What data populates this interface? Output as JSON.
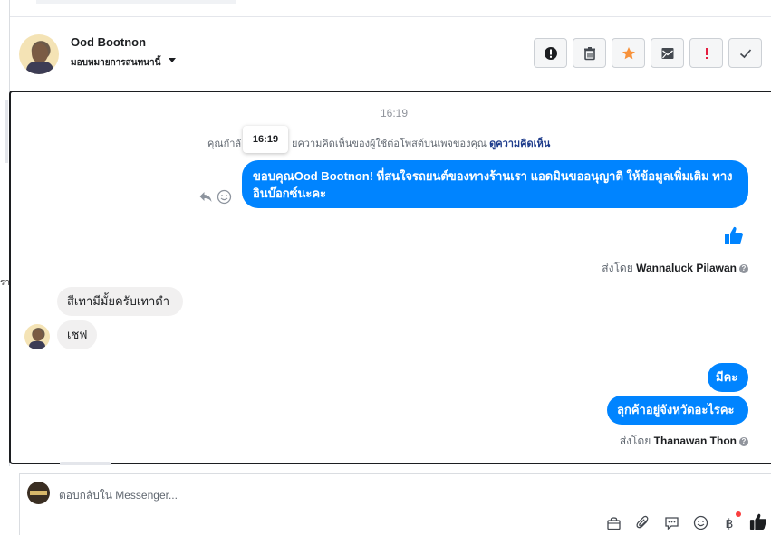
{
  "header": {
    "name": "Ood Bootnon",
    "assign_label": "มอบหมายการสนทนานี้"
  },
  "toolbar": {
    "buttons": [
      {
        "name": "spam-report-button",
        "icon": "alert-circle-icon",
        "color": "#1c1e21"
      },
      {
        "name": "delete-button",
        "icon": "trash-icon",
        "color": "#444950"
      },
      {
        "name": "star-button",
        "icon": "star-icon",
        "color": "#f7923b"
      },
      {
        "name": "mark-unread-button",
        "icon": "envelope-icon",
        "color": "#444950"
      },
      {
        "name": "follow-up-button",
        "icon": "exclamation-icon",
        "color": "#e41e3f"
      },
      {
        "name": "done-button",
        "icon": "check-icon",
        "color": "#444950"
      }
    ]
  },
  "conversation": {
    "timestamp": "16:19",
    "tooltip_time": "16:19",
    "system_message_left": "คุณกำลั",
    "system_message_right": "ยความคิดเห็นของผู้ใช้ต่อโพสต์บนเพจของคุณ",
    "system_link": "ดูความคิดเห็น",
    "outgoing_1": "ขอบคุณOod Bootnon! ที่สนใจรถยนต์ของทางร้านเรา แอดมินขออนุญาติ ให้ข้อมูลเพิ่มเติม ทางอินบ๊อกซ์นะคะ",
    "sent_by_1_prefix": "ส่งโดย",
    "sent_by_1_name": "Wannaluck Pilawan",
    "incoming_1": "สีเทามีมั้ยครับเทาดำ",
    "incoming_2": "เชฟ",
    "outgoing_2": "มีคะ",
    "outgoing_3": "ลุกค้าอยู่จังหวัดอะไรคะ",
    "sent_by_2_prefix": "ส่งโดย",
    "sent_by_2_name": "Thanawan Thon",
    "left_edge_glyph": "รา"
  },
  "composer": {
    "placeholder": "ตอบกลับใน Messenger..."
  },
  "colors": {
    "accent": "#0084ff",
    "incoming_bubble": "#f1f0f0",
    "link": "#1c3a8a",
    "notification": "#fa3e3e"
  }
}
